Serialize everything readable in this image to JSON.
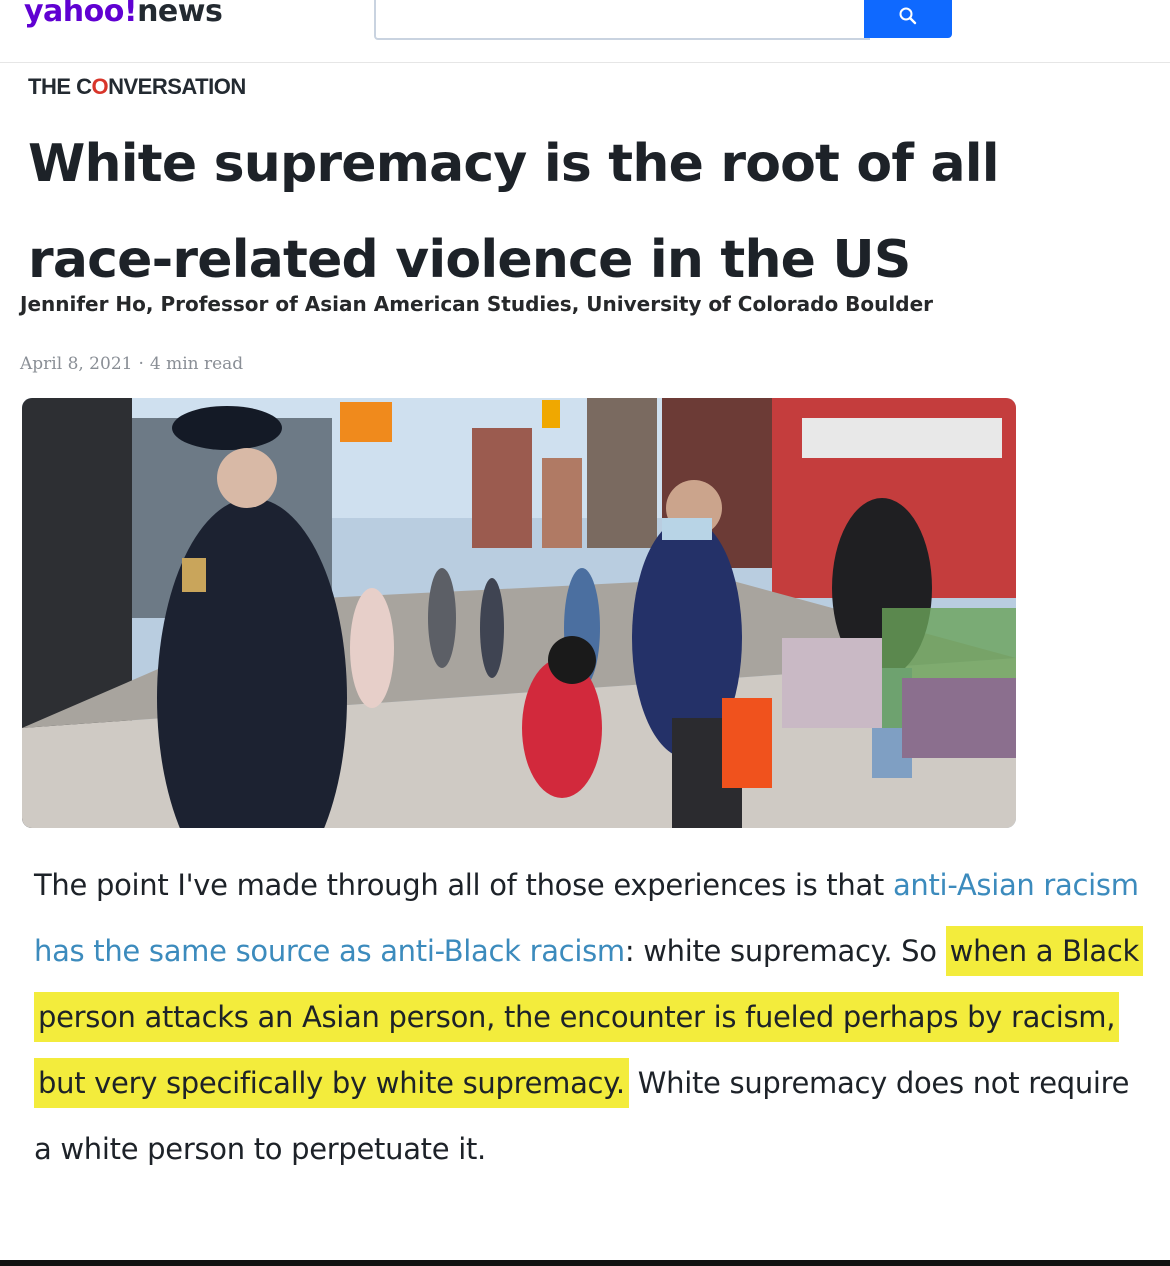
{
  "header": {
    "logo_brand": "yahoo!",
    "logo_section": "news",
    "search": {
      "value": "",
      "placeholder": ""
    },
    "search_button_icon": "search-icon"
  },
  "article": {
    "source": {
      "prefix": "THE C",
      "o_letter": "O",
      "suffix": "NVERSATION"
    },
    "title": "White supremacy is the root of all race-related violence in the US",
    "author": "Jennifer Ho, Professor of Asian American Studies, University of Colorado Boulder",
    "date": "April 8, 2021",
    "separator": "·",
    "read_time": "4 min read",
    "body": {
      "seg1": "The point I've made through all of those experiences is that ",
      "link": "anti-Asian racism has the same source as anti-Black racism",
      "seg2": ": white supremacy. So ",
      "highlight": "when a Black person attacks an Asian person, the encounter is fueled perhaps by racism, but very specifically by white supremacy.",
      "seg3": " White supremacy does not require a white person to perpetuate it."
    }
  },
  "colors": {
    "brand": "#6001d2",
    "search_button": "#0f69ff",
    "link": "#3c8bbd",
    "highlight": "#f3ec3c"
  }
}
